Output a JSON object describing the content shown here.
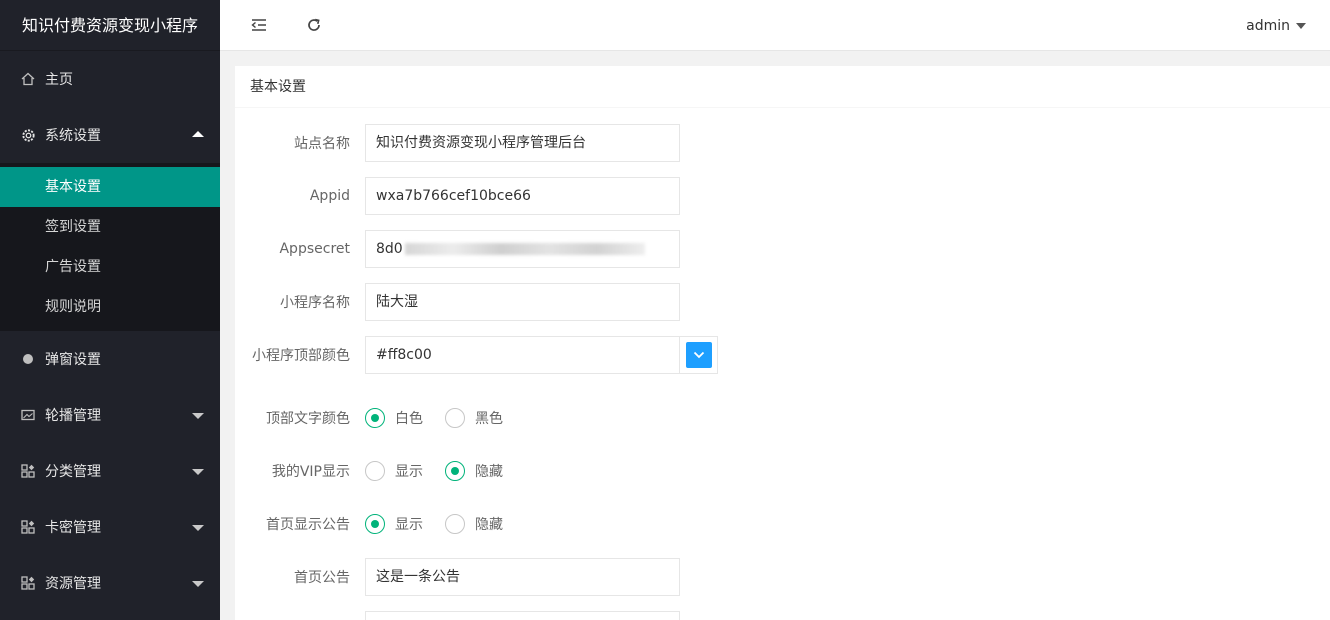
{
  "sidebar": {
    "title": "知识付费资源变现小程序",
    "items": [
      {
        "label": "主页"
      },
      {
        "label": "系统设置"
      },
      {
        "label": "弹窗设置"
      },
      {
        "label": "轮播管理"
      },
      {
        "label": "分类管理"
      },
      {
        "label": "卡密管理"
      },
      {
        "label": "资源管理"
      }
    ],
    "submenu": [
      {
        "label": "基本设置"
      },
      {
        "label": "签到设置"
      },
      {
        "label": "广告设置"
      },
      {
        "label": "规则说明"
      }
    ]
  },
  "header": {
    "user": "admin"
  },
  "card": {
    "title": "基本设置"
  },
  "form": {
    "site_name_label": "站点名称",
    "site_name": "知识付费资源变现小程序管理后台",
    "appid_label": "Appid",
    "appid": "wxa7b766cef10bce66",
    "appsecret_label": "Appsecret",
    "appsecret_visible": "8d0",
    "mp_name_label": "小程序名称",
    "mp_name": "陆大湿",
    "top_color_label": "小程序顶部颜色",
    "top_color": "#ff8c00",
    "text_color_label": "顶部文字颜色",
    "text_color_options": [
      "白色",
      "黑色"
    ],
    "vip_label": "我的VIP显示",
    "vip_options": [
      "显示",
      "隐藏"
    ],
    "notice_show_label": "首页显示公告",
    "notice_show_options": [
      "显示",
      "隐藏"
    ],
    "notice_label": "首页公告",
    "notice": "这是一条公告"
  },
  "colors": {
    "accent": "#009688",
    "radio": "#00b37a",
    "color_picker": "#1e9fff"
  }
}
